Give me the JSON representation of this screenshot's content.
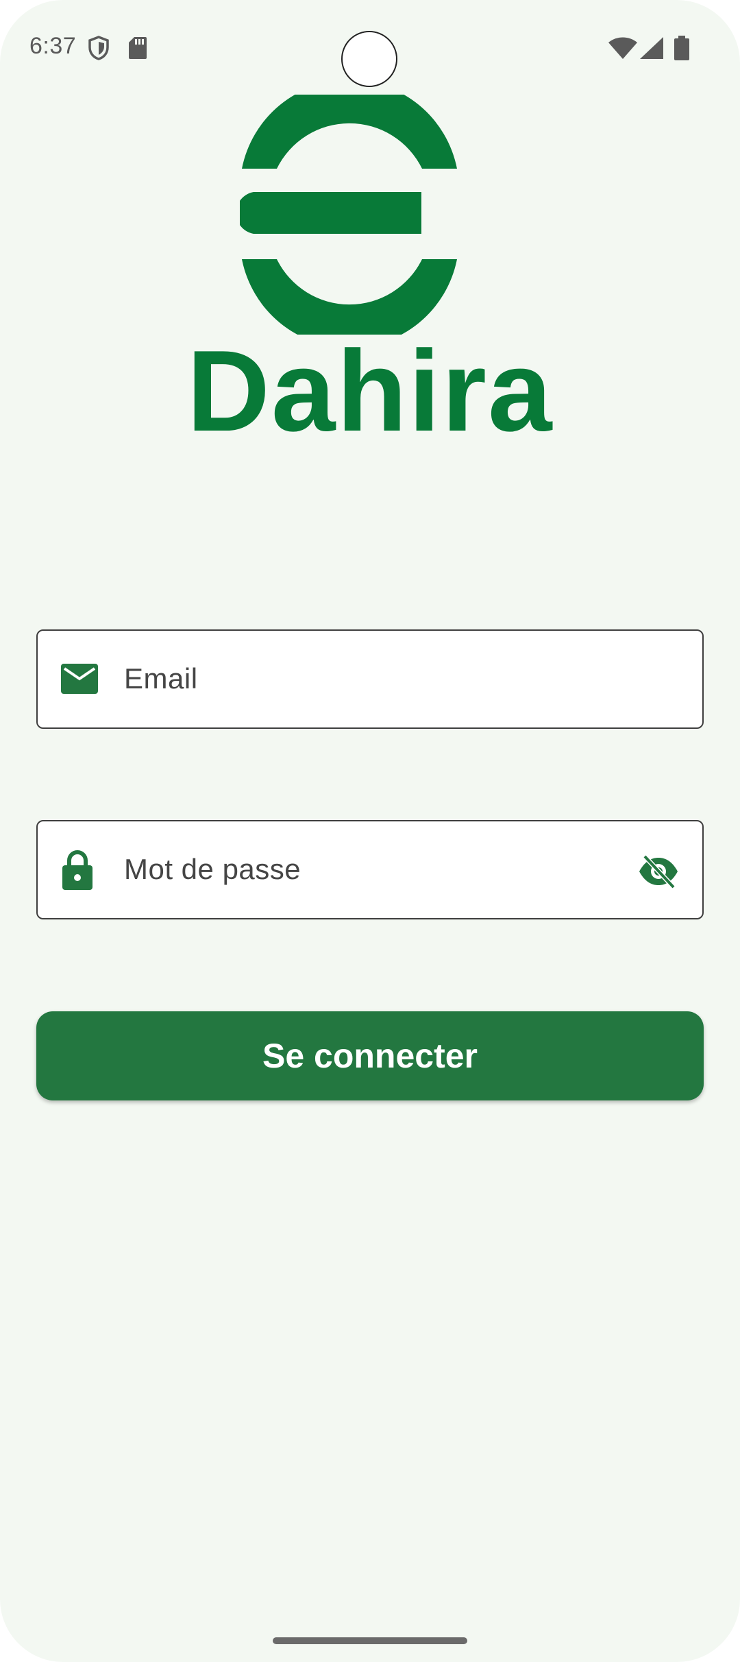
{
  "status_bar": {
    "time": "6:37",
    "left_icons": [
      "shield-icon",
      "sd-card-icon"
    ],
    "right_icons": [
      "wifi-icon",
      "signal-icon",
      "battery-icon"
    ]
  },
  "brand": {
    "name": "Dahira",
    "color": "#087a38"
  },
  "login_form": {
    "email": {
      "placeholder": "Email",
      "icon": "mail-icon"
    },
    "password": {
      "placeholder": "Mot de passe",
      "icon": "lock-icon",
      "toggle_icon": "visibility-off-icon"
    },
    "submit_label": "Se connecter"
  },
  "colors": {
    "background": "#f3f8f2",
    "accent": "#237740"
  }
}
